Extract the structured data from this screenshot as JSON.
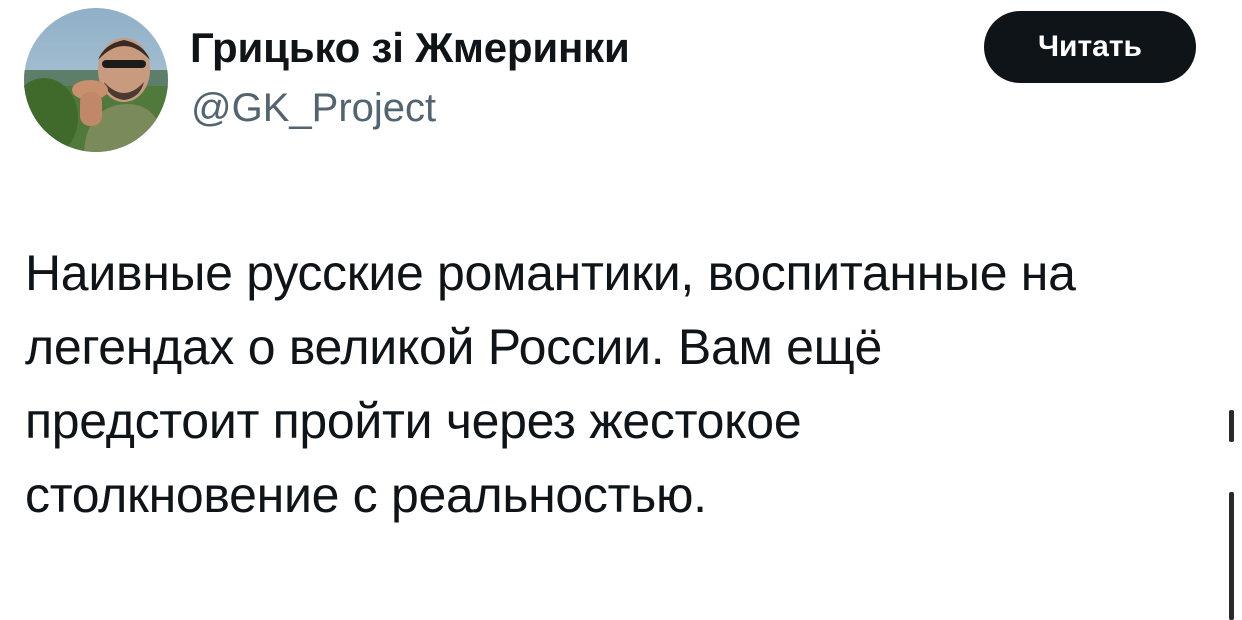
{
  "author": {
    "display_name": "Грицько зі Жмеринки",
    "handle": "@GK_Project"
  },
  "follow_button": {
    "label": "Читать"
  },
  "tweet": {
    "text": "Наивные русские романтики, воспитанные на\nлегендах о великой России. Вам ещё\nпредстоит пройти через жестокое\nстолкновение с реальностью."
  },
  "colors": {
    "text_primary": "#0f1419",
    "text_secondary": "#536471",
    "button_bg": "#0f1419",
    "button_text": "#ffffff",
    "background": "#ffffff"
  },
  "icons": {
    "avatar": "profile-photo"
  }
}
